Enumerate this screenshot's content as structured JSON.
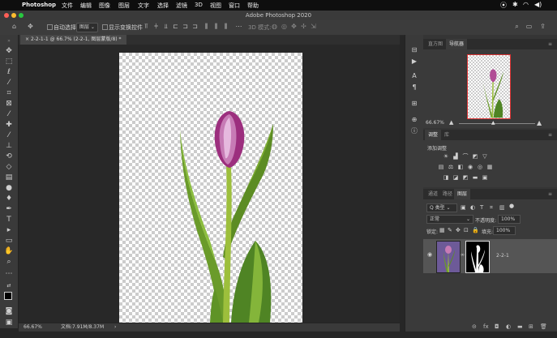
{
  "menubar": {
    "app_name": "Photoshop",
    "items": [
      "文件",
      "编辑",
      "图像",
      "图层",
      "文字",
      "选择",
      "滤镜",
      "3D",
      "视图",
      "窗口",
      "帮助"
    ],
    "battery": "◀)"
  },
  "window": {
    "title": "Adobe Photoshop 2020"
  },
  "options": {
    "auto_select_label": "自动选择:",
    "auto_select_value": "图层",
    "show_transform_label": "显示变换控件",
    "mode_3d_label": "3D 模式:"
  },
  "document": {
    "tab_label": "2-2-1-1 @ 66.7% (2-2-1, 图层蒙版/8) *",
    "zoom": "66.67%",
    "doc_info": "文档:7.91M/8.37M"
  },
  "panels": {
    "tabs_top": [
      "直方图",
      "导航器"
    ],
    "navigator_zoom": "66.67%",
    "tabs_mid": [
      "调整",
      "库"
    ],
    "adjust_hint": "添加调整",
    "tabs_layers": [
      "通道",
      "路径",
      "图层"
    ],
    "filter_kind": "Q 类型",
    "blend_mode": "正常",
    "opacity_label": "不透明度:",
    "opacity_value": "100%",
    "lock_label": "锁定:",
    "fill_label": "填充:",
    "fill_value": "100%",
    "layer_name": "2-2-1"
  },
  "colors": {
    "accent_select": "#555555",
    "bg_canvas": "#282828",
    "panel": "#3a3a3a"
  }
}
